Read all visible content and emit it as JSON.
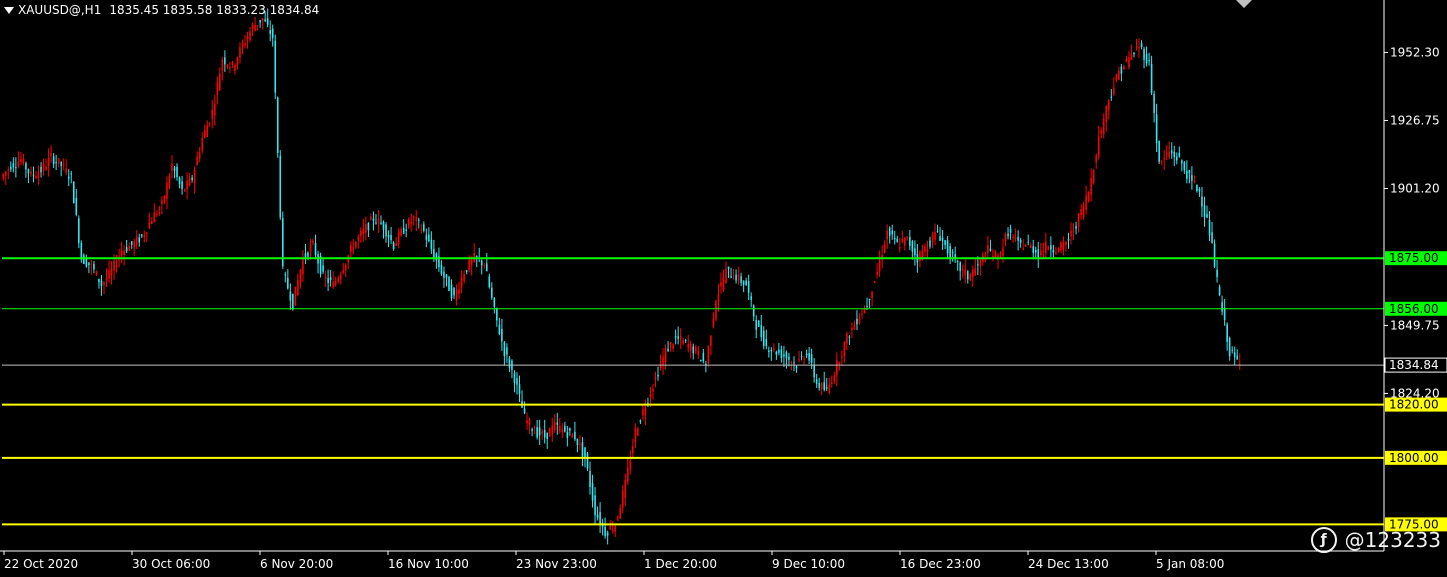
{
  "header": {
    "symbol": "XAUUSD@,H1",
    "ohlc": "1835.45 1835.58 1833.23 1834.84"
  },
  "watermark": {
    "text": "@123233",
    "icon": "weibo-icon"
  },
  "colors": {
    "background": "#000000",
    "axis": "#ffffff",
    "bull_candle": "#ff0000",
    "bear_candle": "#33e6f0",
    "level_green": "#00ff00",
    "level_yellow": "#ffff00",
    "current_price_line": "#c0c0c0"
  },
  "chart_data": {
    "type": "candlestick",
    "instrument": "XAUUSD@",
    "timeframe": "H1",
    "y_range": [
      1765,
      1972
    ],
    "y_ticks": [
      1952.3,
      1926.75,
      1901.2,
      1875.0,
      1856.0,
      1849.75,
      1834.84,
      1824.2,
      1820.0,
      1800.0,
      1775.0
    ],
    "x_tick_labels": [
      "22 Oct 2020",
      "30 Oct 06:00",
      "6 Nov 20:00",
      "16 Nov 10:00",
      "23 Nov 23:00",
      "1 Dec 20:00",
      "9 Dec 10:00",
      "16 Dec 23:00",
      "24 Dec 13:00",
      "5 Jan 08:00"
    ],
    "horizontal_levels": [
      {
        "value": 1875.0,
        "label": "1875.00",
        "color": "#00ff00"
      },
      {
        "value": 1856.0,
        "label": "1856.00",
        "color": "#00ff00"
      },
      {
        "value": 1820.0,
        "label": "1820.00",
        "color": "#ffff00"
      },
      {
        "value": 1800.0,
        "label": "1800.00",
        "color": "#ffff00"
      },
      {
        "value": 1775.0,
        "label": "1775.00",
        "color": "#ffff00"
      }
    ],
    "current_price": 1834.84,
    "price_path": [
      1905,
      1910,
      1912,
      1906,
      1908,
      1913,
      1910,
      1905,
      1875,
      1872,
      1865,
      1870,
      1878,
      1880,
      1883,
      1890,
      1895,
      1910,
      1900,
      1905,
      1920,
      1930,
      1950,
      1947,
      1955,
      1962,
      1965,
      1958,
      1870,
      1858,
      1875,
      1880,
      1868,
      1865,
      1872,
      1880,
      1885,
      1890,
      1887,
      1880,
      1886,
      1890,
      1885,
      1876,
      1868,
      1860,
      1870,
      1875,
      1873,
      1855,
      1840,
      1830,
      1815,
      1810,
      1808,
      1812,
      1810,
      1808,
      1800,
      1780,
      1772,
      1775,
      1790,
      1810,
      1820,
      1830,
      1840,
      1845,
      1843,
      1840,
      1835,
      1860,
      1870,
      1868,
      1865,
      1850,
      1842,
      1840,
      1838,
      1835,
      1840,
      1828,
      1825,
      1835,
      1845,
      1852,
      1858,
      1870,
      1885,
      1880,
      1882,
      1875,
      1880,
      1885,
      1878,
      1872,
      1868,
      1872,
      1878,
      1875,
      1885,
      1880,
      1880,
      1877,
      1880,
      1878,
      1882,
      1890,
      1900,
      1920,
      1935,
      1945,
      1950,
      1955,
      1948,
      1910,
      1915,
      1912,
      1905,
      1900,
      1885,
      1860,
      1840,
      1834.84
    ]
  }
}
